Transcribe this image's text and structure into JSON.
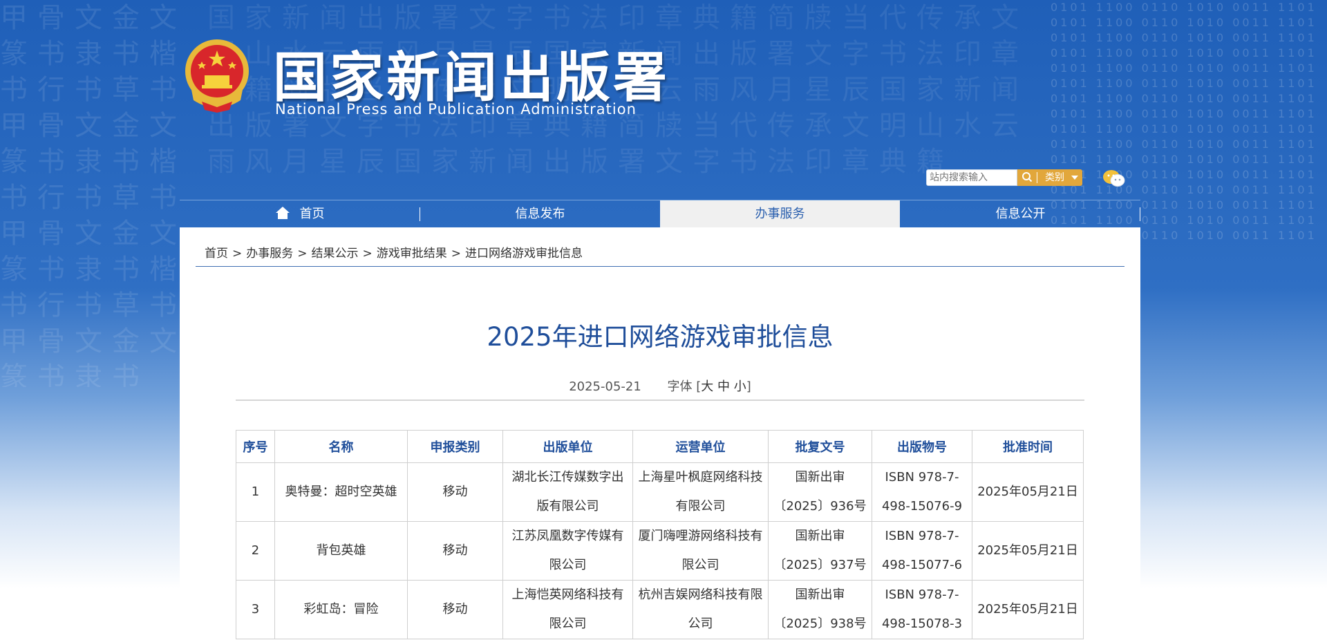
{
  "header": {
    "site_title": "国家新闻出版署",
    "site_subtitle": "National Press and Publication Administration",
    "search": {
      "placeholder": "站内搜索输入",
      "category_label": "类别"
    }
  },
  "nav": {
    "items": [
      {
        "label": "首页"
      },
      {
        "label": "信息发布"
      },
      {
        "label": "办事服务"
      },
      {
        "label": "信息公开"
      }
    ]
  },
  "breadcrumb": [
    "首页",
    "办事服务",
    "结果公示",
    "游戏审批结果",
    "进口网络游戏审批信息"
  ],
  "article": {
    "title": "2025年进口网络游戏审批信息",
    "date": "2025-05-21",
    "font_label": "字体",
    "font_sizes": [
      "大",
      "中",
      "小"
    ]
  },
  "table": {
    "headers": [
      "序号",
      "名称",
      "申报类别",
      "出版单位",
      "运营单位",
      "批复文号",
      "出版物号",
      "批准时间"
    ],
    "rows": [
      [
        "1",
        "奥特曼：超时空英雄",
        "移动",
        "湖北长江传媒数字出版有限公司",
        "上海星叶枫庭网络科技有限公司",
        "国新出审〔2025〕936号",
        "ISBN 978-7-498-15076-9",
        "2025年05月21日"
      ],
      [
        "2",
        "背包英雄",
        "移动",
        "江苏凤凰数字传媒有限公司",
        "厦门嗨哩游网络科技有限公司",
        "国新出审〔2025〕937号",
        "ISBN 978-7-498-15077-6",
        "2025年05月21日"
      ],
      [
        "3",
        "彩虹岛：冒险",
        "移动",
        "上海恺英网络科技有限公司",
        "杭州吉娱网络科技有限公司",
        "国新出审〔2025〕938号",
        "ISBN 978-7-498-15078-3",
        "2025年05月21日"
      ]
    ]
  },
  "colors": {
    "brand_blue": "#1f4e9a",
    "search_orange": "#e2a73b"
  }
}
